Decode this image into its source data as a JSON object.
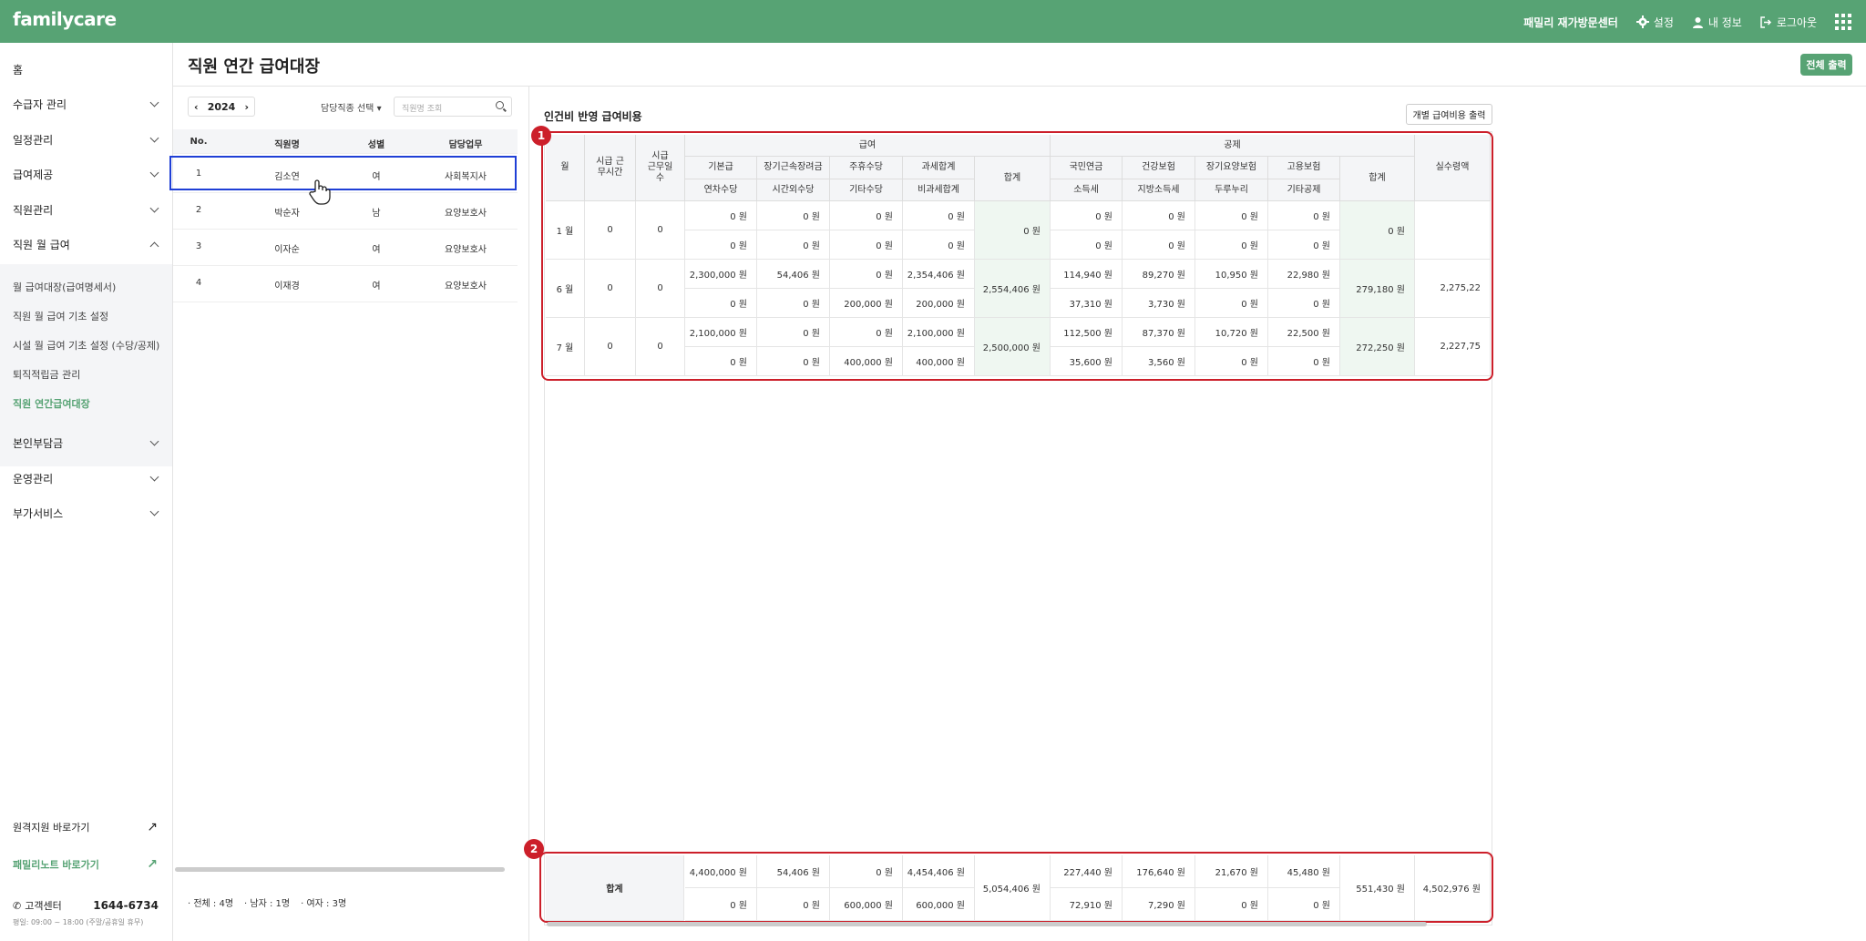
{
  "topbar": {
    "logo": "familycare",
    "org": "패밀리 재가방문센터",
    "settings": "설정",
    "myinfo": "내 정보",
    "logout": "로그아웃"
  },
  "sidebar": {
    "home": "홈",
    "menus": [
      "수급자 관리",
      "일정관리",
      "급여제공",
      "직원관리",
      "직원 월 급여"
    ],
    "submenus": [
      "월 급여대장(급여명세서)",
      "직원 월 급여 기초 설정",
      "시설 월 급여 기초 설정 (수당/공제)",
      "퇴직적립금 관리",
      "직원 연간급여대장"
    ],
    "menus2": [
      "본인부담금",
      "운영관리",
      "부가서비스"
    ],
    "remote": "원격지원 바로가기",
    "familynote": "패밀리노트 바로가기",
    "cs_label": "고객센터",
    "cs_phone": "1644-6734",
    "cs_hours": "평일: 09:00 ~ 18:00 (주말/공휴일 휴무)"
  },
  "page": {
    "title": "직원 연간 급여대장",
    "print_all": "전체 출력",
    "year": "2024",
    "job_select": "담당직종 선택",
    "search_placeholder": "직원명 조회",
    "section_title": "인건비 반영 급여비용",
    "indiv_print": "개별 급여비용 출력"
  },
  "employees": {
    "headers": [
      "No.",
      "직원명",
      "성별",
      "담당업무"
    ],
    "rows": [
      [
        "1",
        "김소연",
        "여",
        "사회복지사"
      ],
      [
        "2",
        "박순자",
        "남",
        "요양보호사"
      ],
      [
        "3",
        "이자순",
        "여",
        "요양보호사"
      ],
      [
        "4",
        "이재경",
        "여",
        "요양보호사"
      ]
    ],
    "counts": [
      "· 전체 : 4명",
      "· 남자 : 1명",
      "· 여자 : 3명"
    ]
  },
  "payroll": {
    "headers": {
      "month": "월",
      "hours": "시급 근무시간",
      "days": "시급 근무일수",
      "pay": "급여",
      "deduct": "공제",
      "net": "실수령액",
      "sum": "합계",
      "pay_top": [
        "기본급",
        "장기근속장려금",
        "주휴수당",
        "과세합계"
      ],
      "pay_bottom": [
        "연차수당",
        "시간외수당",
        "기타수당",
        "비과세합계"
      ],
      "ded_top": [
        "국민연금",
        "건강보험",
        "장기요양보험",
        "고용보험"
      ],
      "ded_bottom": [
        "소득세",
        "지방소득세",
        "두루누리",
        "기타공제"
      ]
    },
    "rows": [
      {
        "month": "1 월",
        "hours": "0",
        "days": "0",
        "pay_top": [
          "0 원",
          "0 원",
          "0 원",
          "0 원"
        ],
        "pay_bottom": [
          "0 원",
          "0 원",
          "0 원",
          "0 원"
        ],
        "pay_sum": "0 원",
        "ded_top": [
          "0 원",
          "0 원",
          "0 원",
          "0 원"
        ],
        "ded_bottom": [
          "0 원",
          "0 원",
          "0 원",
          "0 원"
        ],
        "ded_sum": "0 원",
        "net": ""
      },
      {
        "month": "6 월",
        "hours": "0",
        "days": "0",
        "pay_top": [
          "2,300,000 원",
          "54,406 원",
          "0 원",
          "2,354,406 원"
        ],
        "pay_bottom": [
          "0 원",
          "0 원",
          "200,000 원",
          "200,000 원"
        ],
        "pay_sum": "2,554,406 원",
        "ded_top": [
          "114,940 원",
          "89,270 원",
          "10,950 원",
          "22,980 원"
        ],
        "ded_bottom": [
          "37,310 원",
          "3,730 원",
          "0 원",
          "0 원"
        ],
        "ded_sum": "279,180 원",
        "net": "2,275,22"
      },
      {
        "month": "7 월",
        "hours": "0",
        "days": "0",
        "pay_top": [
          "2,100,000 원",
          "0 원",
          "0 원",
          "2,100,000 원"
        ],
        "pay_bottom": [
          "0 원",
          "0 원",
          "400,000 원",
          "400,000 원"
        ],
        "pay_sum": "2,500,000 원",
        "ded_top": [
          "112,500 원",
          "87,370 원",
          "10,720 원",
          "22,500 원"
        ],
        "ded_bottom": [
          "35,600 원",
          "3,560 원",
          "0 원",
          "0 원"
        ],
        "ded_sum": "272,250 원",
        "net": "2,227,75"
      }
    ],
    "total": {
      "label": "합계",
      "pay_top": [
        "4,400,000 원",
        "54,406 원",
        "0 원",
        "4,454,406 원"
      ],
      "pay_bottom": [
        "0 원",
        "0 원",
        "600,000 원",
        "600,000 원"
      ],
      "pay_sum": "5,054,406 원",
      "ded_top": [
        "227,440 원",
        "176,640 원",
        "21,670 원",
        "45,480 원"
      ],
      "ded_bottom": [
        "72,910 원",
        "7,290 원",
        "0 원",
        "0 원"
      ],
      "ded_sum": "551,430 원",
      "net": "4,502,976 원"
    }
  },
  "annotations": [
    "1",
    "2"
  ],
  "colors": {
    "brand": "#57a374",
    "highlight": "#1f3fd6",
    "annotation": "#cc1f2a"
  }
}
